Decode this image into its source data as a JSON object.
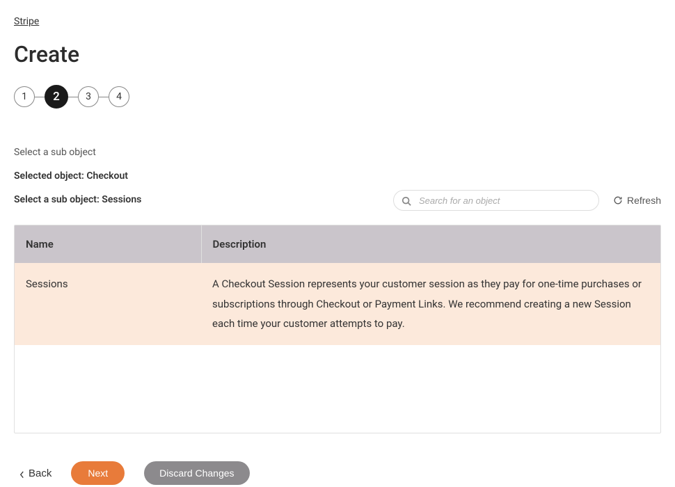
{
  "breadcrumb": "Stripe",
  "page_title": "Create",
  "stepper": {
    "steps": [
      "1",
      "2",
      "3",
      "4"
    ],
    "active_index": 1
  },
  "instructions": {
    "select_sub": "Select a sub object",
    "selected_object": "Selected object: Checkout",
    "select_sub_line": "Select a sub object: Sessions"
  },
  "search": {
    "placeholder": "Search for an object"
  },
  "refresh_label": "Refresh",
  "table": {
    "headers": {
      "name": "Name",
      "description": "Description"
    },
    "rows": [
      {
        "name": "Sessions",
        "description": "A Checkout Session represents your customer session as they pay for one-time purchases or subscriptions through Checkout or Payment Links. We recommend creating a new Session each time your customer attempts to pay.",
        "selected": true
      }
    ]
  },
  "footer": {
    "back": "Back",
    "next": "Next",
    "discard": "Discard Changes"
  }
}
